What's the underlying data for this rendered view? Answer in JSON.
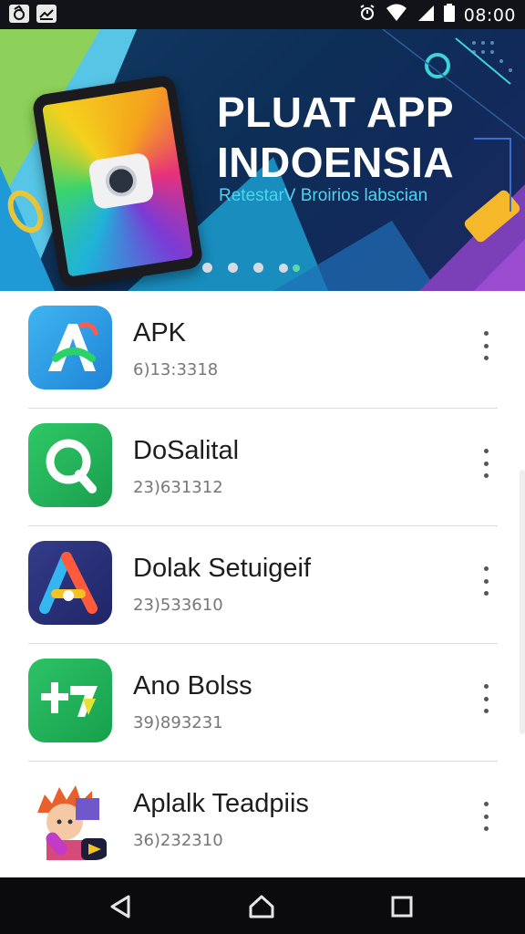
{
  "status_bar": {
    "time": "08:00",
    "left_icons": [
      "app-notification-icon",
      "screenshot-notification-icon"
    ],
    "right_icons": [
      "alarm-icon",
      "wifi-icon",
      "signal-icon",
      "battery-icon"
    ]
  },
  "banner": {
    "title_line1": "PLUAT APP",
    "title_line2": "INDOENSIA",
    "subtitle": "RetestarV Broirios labscian",
    "page_count": 4,
    "active_page": 4
  },
  "apps": [
    {
      "name": "APK",
      "meta": "6)13:3318",
      "icon": "apk-a-icon",
      "color": "#2c9fe6"
    },
    {
      "name": "DoSalital",
      "meta": "23)631312",
      "icon": "search-q-icon",
      "color": "#26b05a"
    },
    {
      "name": "Dolak Setuigeif",
      "meta": "23)533610",
      "icon": "triangle-a-icon",
      "color": "#2a3275"
    },
    {
      "name": "Ano Bolss",
      "meta": "39)893231",
      "icon": "tv-letters-icon",
      "color": "#22b35c"
    },
    {
      "name": "Aplalk Teadpiis",
      "meta": "36)232310",
      "icon": "character-avatar-icon",
      "color": "#ffffff"
    }
  ],
  "nav": {
    "icons": [
      "back-icon",
      "home-icon",
      "recents-icon"
    ]
  }
}
